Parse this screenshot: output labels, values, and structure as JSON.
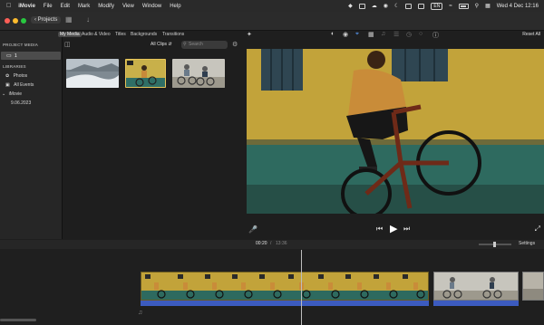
{
  "menubar": {
    "app_name": "iMovie",
    "items": [
      "File",
      "Edit",
      "Mark",
      "Modify",
      "View",
      "Window",
      "Help"
    ],
    "language": "EN",
    "datetime": "Wed 4 Dec  12:16"
  },
  "toolbar": {
    "projects_label": "Projects",
    "reset_all": "Reset All"
  },
  "sidebar": {
    "project_media_header": "PROJECT MEDIA",
    "project_item": "1",
    "libraries_header": "LIBRARIES",
    "library_items": [
      "Photos",
      "All Events"
    ],
    "library_name": "iMovie",
    "event_date": "9.06.2023"
  },
  "browser": {
    "tabs": [
      "My Media",
      "Audio & Video",
      "Titles",
      "Backgrounds",
      "Transitions"
    ],
    "active_tab": "My Media",
    "filter_label": "All Clips",
    "search_placeholder": "Search"
  },
  "timeline": {
    "current_time": "00:20",
    "separator": "/",
    "total_time": "13:36",
    "settings_label": "Settings"
  }
}
